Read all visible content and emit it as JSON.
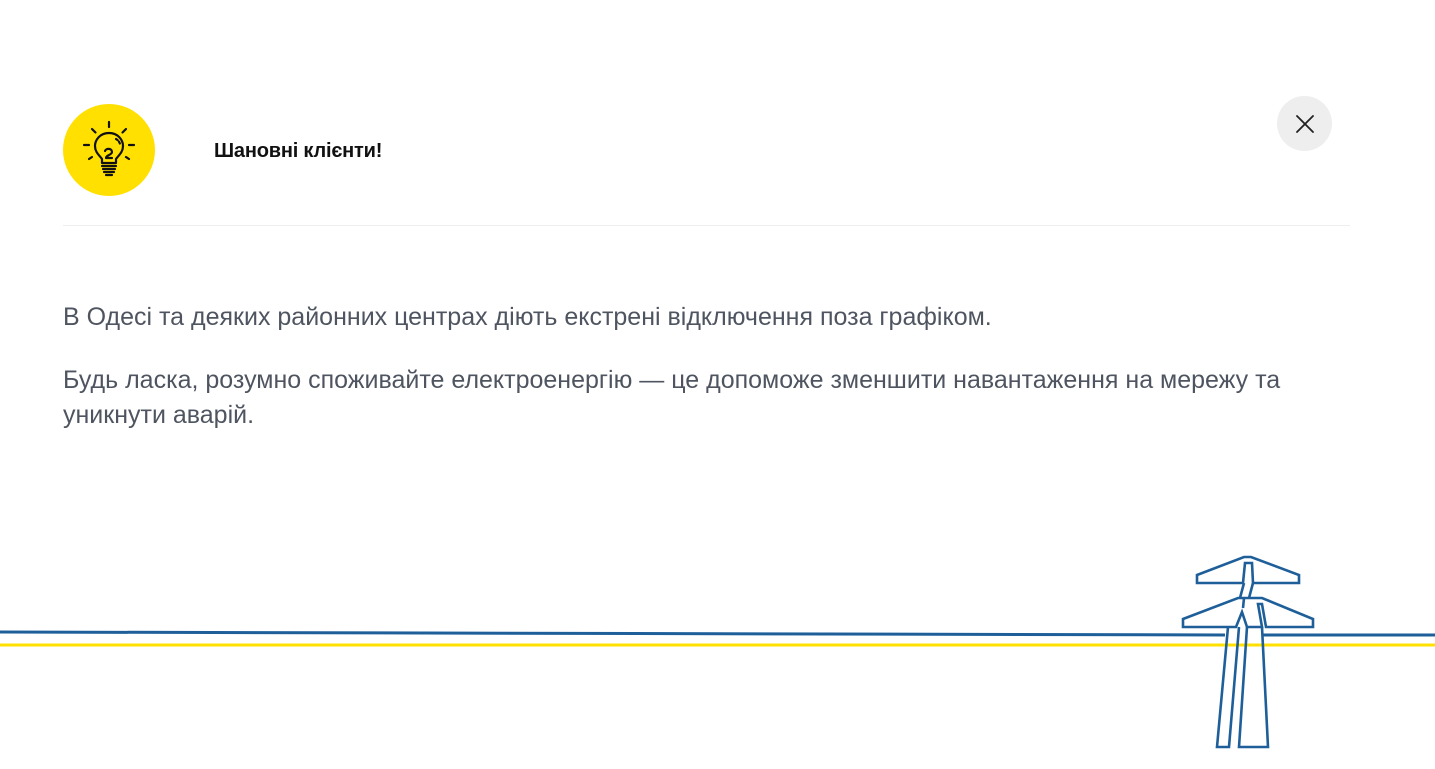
{
  "notice": {
    "title": "Шановні клієнти!",
    "paragraphs": [
      "В Одесі та деяких районних центрах діють екстрені відключення поза графіком.",
      "Будь ласка, розумно споживайте електроенергію — це допоможе зменшити навантаження на мережу та уникнути аварій."
    ],
    "icon": "lightbulb-icon",
    "close_icon": "close-icon",
    "decoration": "power-tower-icon"
  },
  "colors": {
    "brand_yellow": "#ffe000",
    "brand_blue": "#1e5f9a",
    "text_gray": "#4f5560",
    "close_bg": "#eeeeee"
  }
}
